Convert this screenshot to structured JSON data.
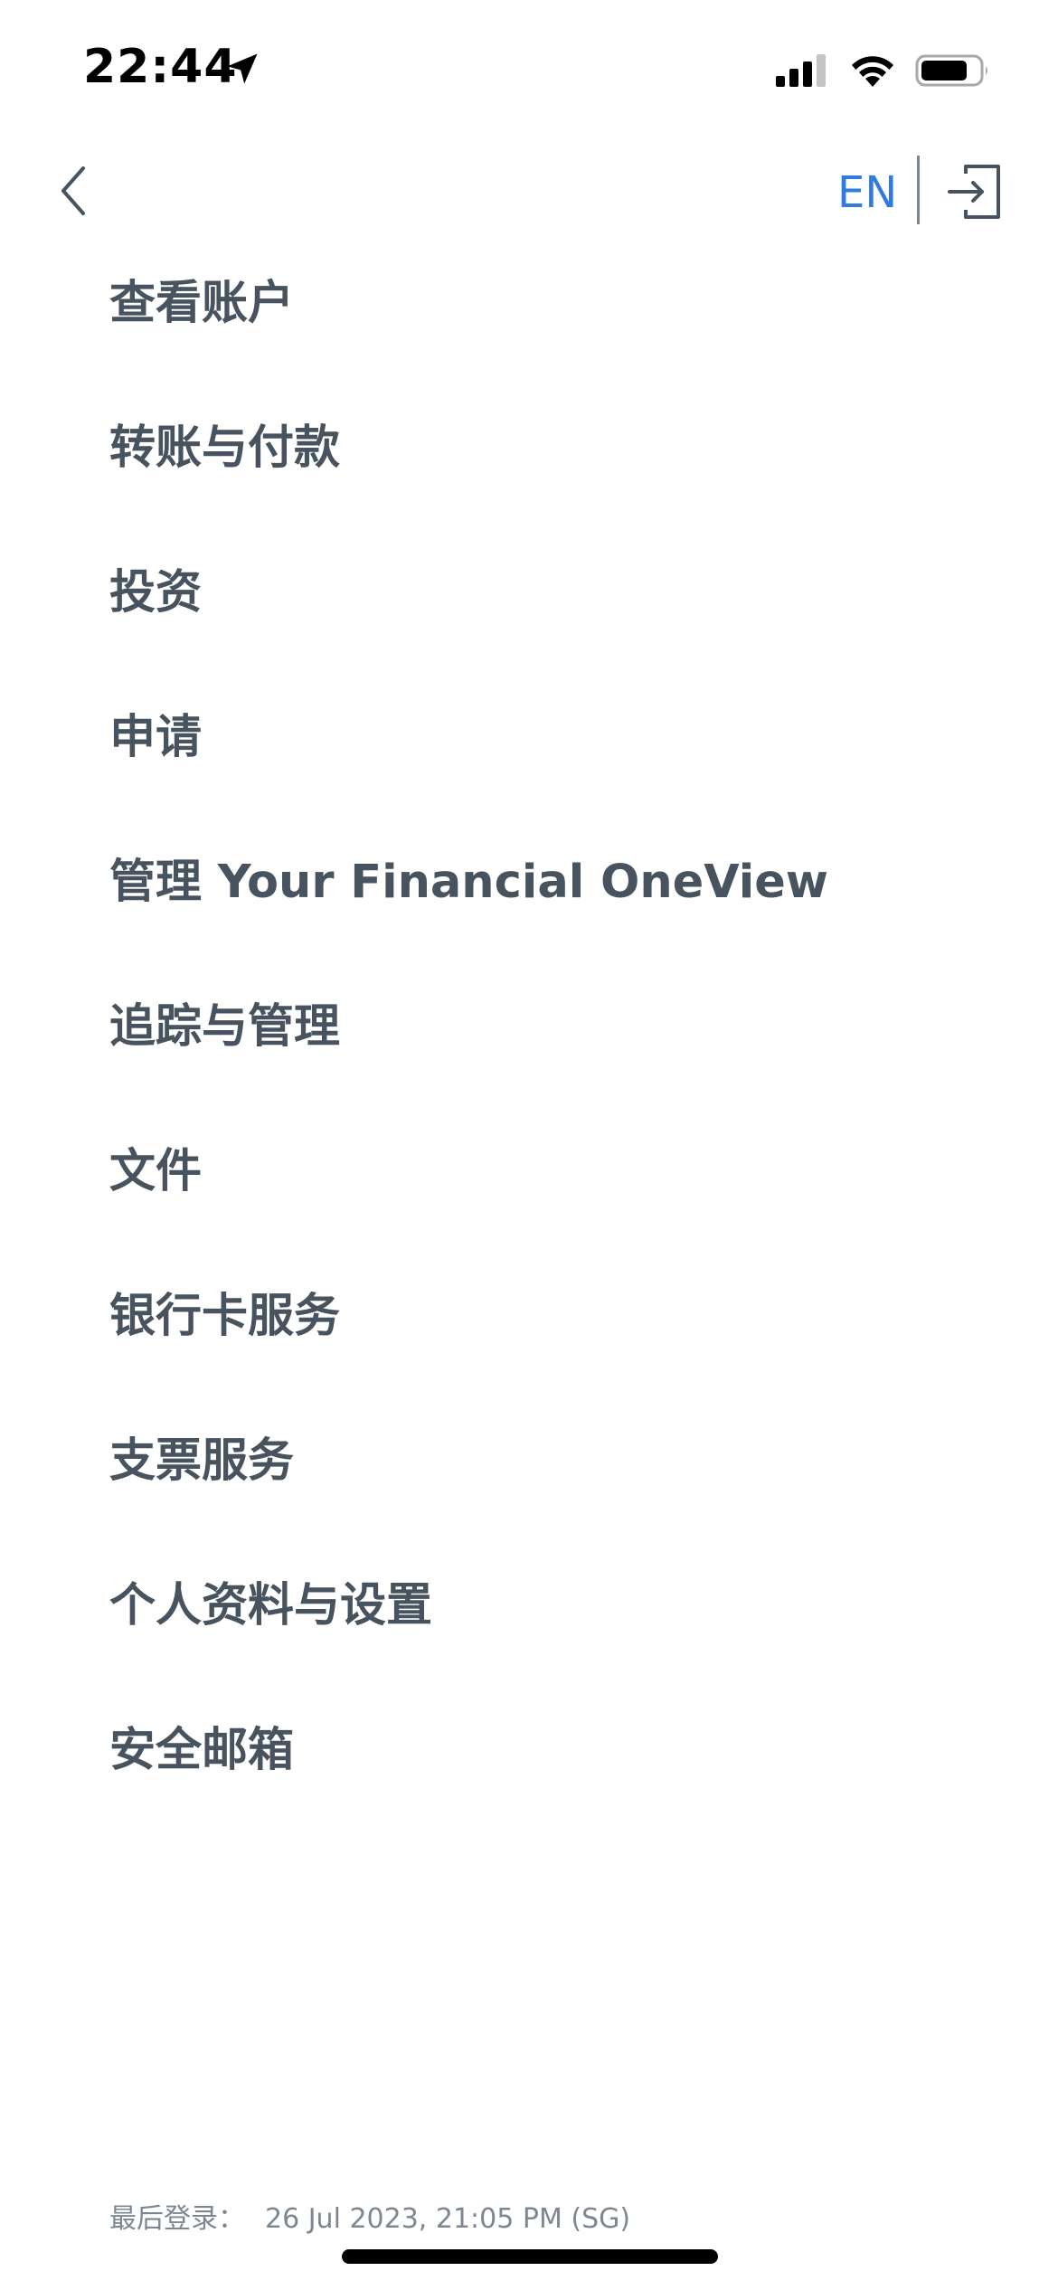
{
  "status_bar": {
    "time": "22:44",
    "icons": [
      "location-arrow-icon",
      "cellular-signal-icon",
      "wifi-icon",
      "battery-icon"
    ]
  },
  "nav": {
    "back_icon": "chevron-left-icon",
    "language_label": "EN",
    "logout_icon": "logout-icon",
    "accent_color": "#2f7be0"
  },
  "menu": {
    "items": [
      {
        "label": "查看账户"
      },
      {
        "label": "转账与付款"
      },
      {
        "label": "投资"
      },
      {
        "label": "申请"
      },
      {
        "label": "管理 Your Financial OneView"
      },
      {
        "label": "追踪与管理"
      },
      {
        "label": "文件"
      },
      {
        "label": "银行卡服务"
      },
      {
        "label": "支票服务"
      },
      {
        "label": "个人资料与设置"
      },
      {
        "label": "安全邮箱"
      }
    ],
    "text_color": "#47535e"
  },
  "footer": {
    "last_login_label": "最后登录：",
    "last_login_value": "26 Jul 2023, 21:05 PM (SG)"
  }
}
